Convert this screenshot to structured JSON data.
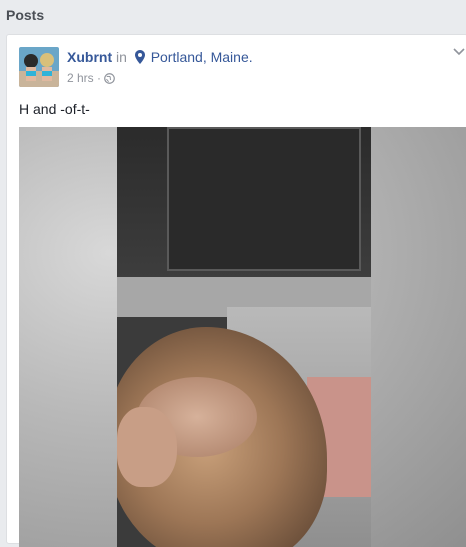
{
  "section": {
    "title": "Posts"
  },
  "post": {
    "author": "Xubrnt",
    "in_word": "in",
    "location": "Portland, Maine.",
    "time": "2 hrs",
    "separator": "·",
    "text": "H and -of-t-",
    "icons": {
      "location": "map-pin-icon",
      "audience": "globe-icon",
      "menu": "chevron-down-icon"
    }
  },
  "colors": {
    "link": "#365899",
    "secondary_text": "#90949c",
    "background": "#e9ebee",
    "card": "#ffffff"
  }
}
